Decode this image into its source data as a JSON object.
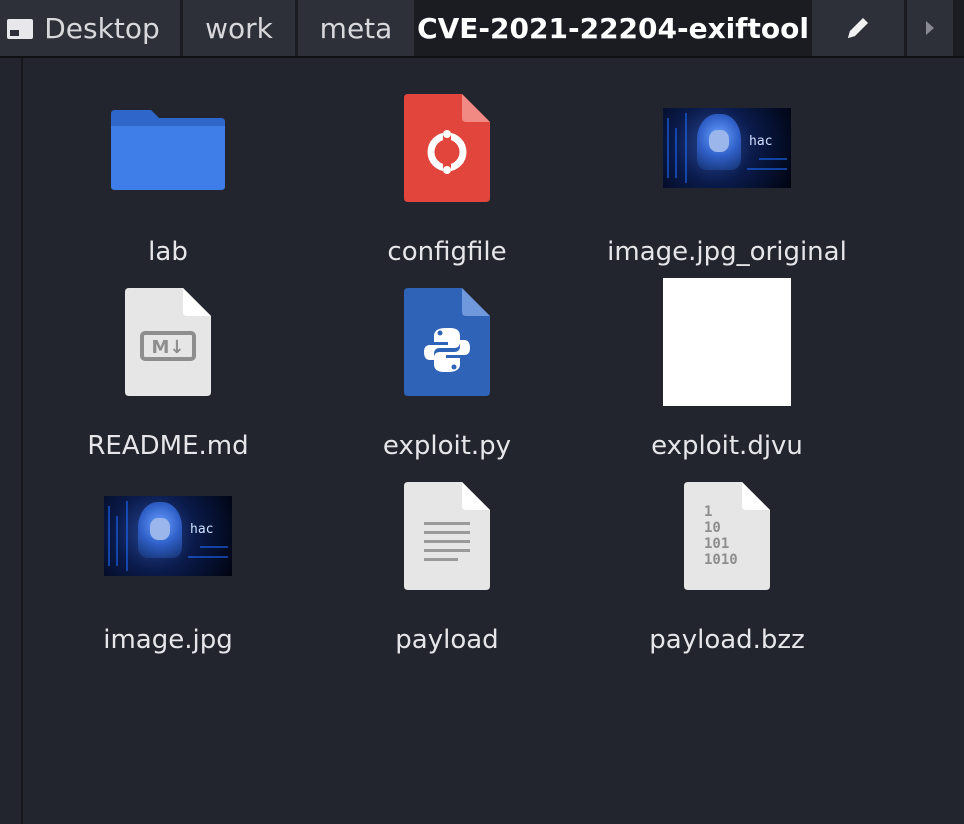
{
  "breadcrumb": {
    "items": [
      {
        "label": "Desktop"
      },
      {
        "label": "work"
      },
      {
        "label": "meta"
      },
      {
        "label": "CVE-2021-22204-exiftool"
      }
    ],
    "edit_icon": "pencil-icon",
    "next_icon": "chevron-right-icon"
  },
  "files": [
    {
      "name": "lab",
      "icon": "folder-icon"
    },
    {
      "name": "configfile",
      "icon": "config-file-icon"
    },
    {
      "name": "image.jpg_original",
      "icon": "image-thumbnail"
    },
    {
      "name": "README.md",
      "icon": "markdown-file-icon"
    },
    {
      "name": "exploit.py",
      "icon": "python-file-icon"
    },
    {
      "name": "exploit.djvu",
      "icon": "blank-image-thumbnail"
    },
    {
      "name": "image.jpg",
      "icon": "image-thumbnail"
    },
    {
      "name": "payload",
      "icon": "text-file-icon"
    },
    {
      "name": "payload.bzz",
      "icon": "binary-file-icon"
    }
  ],
  "thumb_text": "hac",
  "markdown_badge": "M↓",
  "binary_lines": [
    "1",
    "10",
    "101",
    "1010"
  ],
  "colors": {
    "folder": "#3f7ee8",
    "config": "#e2453c",
    "python": "#2f63b8",
    "paper": "#e6e6e6"
  }
}
